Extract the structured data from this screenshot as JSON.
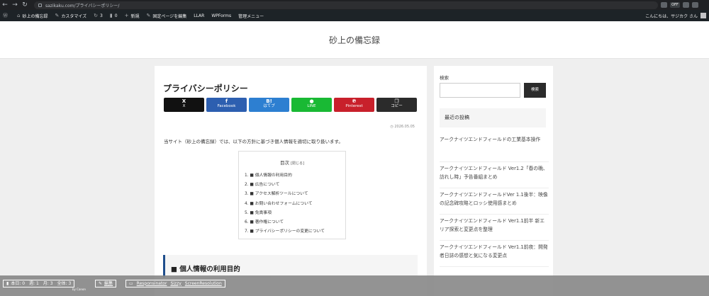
{
  "browser": {
    "url": "sazikaku.com/プライバシーポリシー/",
    "back_icon": "←",
    "forward_icon": "→",
    "reload_icon": "↻",
    "ext_label": "OFF"
  },
  "admin_bar": {
    "site_name": "砂上の備忘録",
    "customize": "カスタマイズ",
    "updates": "3",
    "comments": "0",
    "new": "新規",
    "edit_page": "固定ページを編集",
    "llar": "LLAR",
    "wpforms": "WPForms",
    "admin_menu": "管理メニュー",
    "greeting": "こんにちは、サジカク さん"
  },
  "site": {
    "title": "砂上の備忘録"
  },
  "post": {
    "title": "プライバシーポリシー",
    "date": "2026.05.05",
    "intro": "当サイト（砂上の備忘録）では、以下の方針に基づき個人情報を適切に取り扱います。",
    "share_buttons": [
      {
        "icon": "X",
        "label": "X",
        "color": "#111111"
      },
      {
        "icon": "f",
        "label": "Facebook",
        "color": "#2d5fb0"
      },
      {
        "icon": "B!",
        "label": "はてブ",
        "color": "#2d7fd1"
      },
      {
        "icon": "●",
        "label": "LINE",
        "color": "#19b934"
      },
      {
        "icon": "℗",
        "label": "Pinterest",
        "color": "#c8202b"
      },
      {
        "icon": "❐",
        "label": "コピー",
        "color": "#2b2b2b"
      }
    ]
  },
  "toc": {
    "title": "目次",
    "toggle": "[閉じる]",
    "items": [
      "1. ■ 個人情報の利用目的",
      "2. ■ 広告について",
      "3. ■ アクセス解析ツールについて",
      "4. ■ お問い合わせフォームについて",
      "5. ■ 免責事項",
      "6. ■ 著作権について",
      "7. ■ プライバシーポリシーの変更について"
    ]
  },
  "section": {
    "heading": "■ 個人情報の利用目的"
  },
  "sidebar": {
    "search_label": "検索",
    "search_placeholder": "",
    "search_button": "検索",
    "recent_heading": "最近の投稿",
    "recent_posts": [
      "アークナイツエンドフィールドの工業基本操作",
      "アークナイツエンドフィールド Ver1.2「春の晩、訪れし時」予告番組まとめ",
      "アークナイツエンドフィールドVer 1.1後半：映像の記念碑攻略とロッシ使用感まとめ",
      "アークナイツエンドフィールド Ver1.1前半 新エリア探索と変更点を整理",
      "アークナイツエンドフィールド Ver1.1前夜：開発者日誌の感想と気になる変更点"
    ]
  },
  "counter_bar": {
    "stats": "本日: 0　週: 1　月: 3　全体: 3",
    "by": "by Canon",
    "edit": "編集",
    "links": [
      "Responsinator",
      "Sizzy",
      "ScreenResolution"
    ]
  }
}
